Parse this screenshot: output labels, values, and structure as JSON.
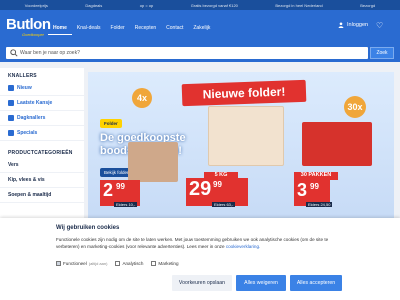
{
  "topbar": [
    "Voordeelprijs",
    "Dagdeals",
    "op = op",
    "Gratis bezorgd vanaf €120",
    "Bezorgd in heel Nederland",
    "Bezorgd"
  ],
  "header": {
    "logo": "Butlon",
    "logo_sub": "Goedkooper",
    "nav": [
      "Home",
      "Knal-deals",
      "Folder",
      "Recepten",
      "Contact",
      "Zakelijk"
    ],
    "active_nav": "Home",
    "login": "Inloggen",
    "favorites_icon": "heart-icon"
  },
  "search": {
    "placeholder": "Waar ben je naar op zoek?",
    "button": "Zoek"
  },
  "sidebar": {
    "knallers_heading": "KNALLERS",
    "knallers": [
      "Nieuw",
      "Laatste Kansje",
      "Dagknallers",
      "Specials"
    ],
    "categories_heading": "PRODUCTCATEGORIEËN",
    "categories": [
      "Vers",
      "Kip, vlees & vis",
      "Soepen & maaltijd"
    ]
  },
  "banner": {
    "bubble_left": "4x",
    "bubble_right": "30x",
    "title": "Nieuwe folder!",
    "badge": "Folder",
    "headline": "De goedkoopste boodschappen!",
    "cta": "Bekijk folder →",
    "products": [
      {
        "price_int": "2",
        "price_dec": "99",
        "was": "Elders 10,-"
      },
      {
        "label": "5 KG",
        "price_int": "29",
        "price_dec": "99",
        "was": "Elders 63,-"
      },
      {
        "label": "30 PAKKEN",
        "price_int": "3",
        "price_dec": "99",
        "was": "Elders 24,50"
      }
    ]
  },
  "cookie": {
    "title": "Wij gebruiken cookies",
    "text": "Functionele cookies zijn nodig om de site te laten werken. Met jouw toestemming gebruiken we ook analytische cookies (om de site te verbeteren) en marketing-cookies (voor relevante advertenties). Lees meer in onze ",
    "link": "cookieverklaring.",
    "options": [
      {
        "label": "Functioneel",
        "note": "(altijd aan)",
        "checked": true
      },
      {
        "label": "Analytisch",
        "checked": false
      },
      {
        "label": "Marketing",
        "checked": false
      }
    ],
    "save": "Voorkeuren opslaan",
    "deny": "Alles weigeren",
    "accept": "Alles accepteren"
  },
  "colors": {
    "brand": "#2a6bd1",
    "price_red": "#e1322f",
    "accent_yellow": "#ffd200"
  }
}
